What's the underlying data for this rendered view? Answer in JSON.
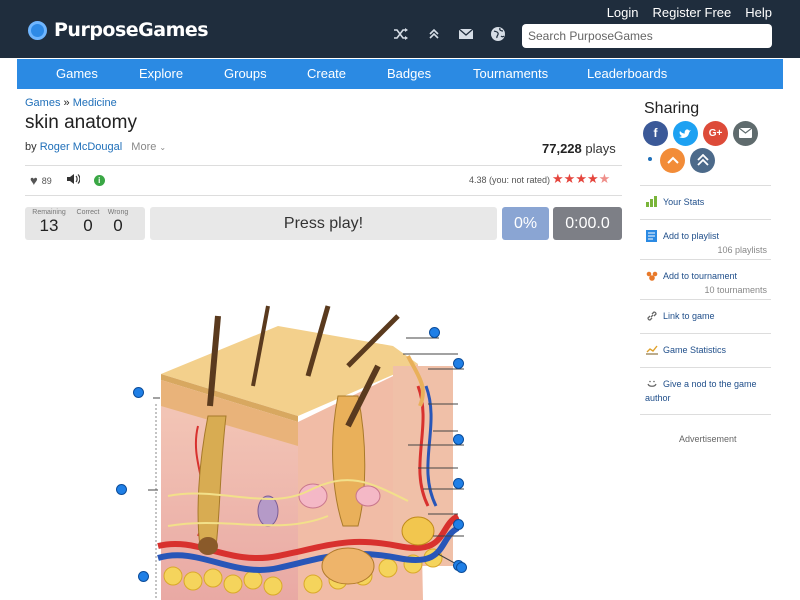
{
  "site": {
    "name": "PurposeGames"
  },
  "top_links": [
    "Login",
    "Register Free",
    "Help"
  ],
  "search": {
    "placeholder": "Search PurposeGames"
  },
  "nav": [
    "Games",
    "Explore",
    "Groups",
    "Create",
    "Badges",
    "Tournaments",
    "Leaderboards"
  ],
  "breadcrumb": {
    "home": "Games",
    "separator": "»",
    "category": "Medicine"
  },
  "quiz": {
    "title": "skin anatomy",
    "by": "by",
    "author": "Roger McDougal",
    "more": "More",
    "plays_count": "77,228",
    "plays_label": "plays",
    "likes": "89",
    "rating_text": "4.38 (you: not rated)",
    "rating_value": 4.38,
    "rating_max": 5
  },
  "game": {
    "remaining_label": "Remaining",
    "remaining": "13",
    "correct_label": "Correct",
    "correct": "0",
    "wrong_label": "Wrong",
    "wrong": "0",
    "press_play": "Press play!",
    "percent": "0%",
    "time": "0:00.0",
    "markers": 13
  },
  "sidebar": {
    "sharing_title": "Sharing",
    "items": [
      {
        "label": "Your Stats",
        "sub": ""
      },
      {
        "label": "Add to playlist",
        "sub": "106 playlists"
      },
      {
        "label": "Add to tournament",
        "sub": "10 tournaments"
      },
      {
        "label": "Link to game",
        "sub": ""
      },
      {
        "label": "Game Statistics",
        "sub": ""
      },
      {
        "label": "Give a nod to the game",
        "sub": "author"
      }
    ],
    "advertisement": "Advertisement"
  },
  "colors": {
    "header": "#1f2d3d",
    "nav": "#2b8ae3",
    "link": "#1f6fb9",
    "star": "#e5453d",
    "marker": "#1f7fe6",
    "facebook": "#3b5998",
    "twitter": "#1da1f2",
    "google": "#dd4b39",
    "email": "#5f6b6d",
    "upvote": "#f28c38",
    "collapse": "#4c6a8a"
  }
}
